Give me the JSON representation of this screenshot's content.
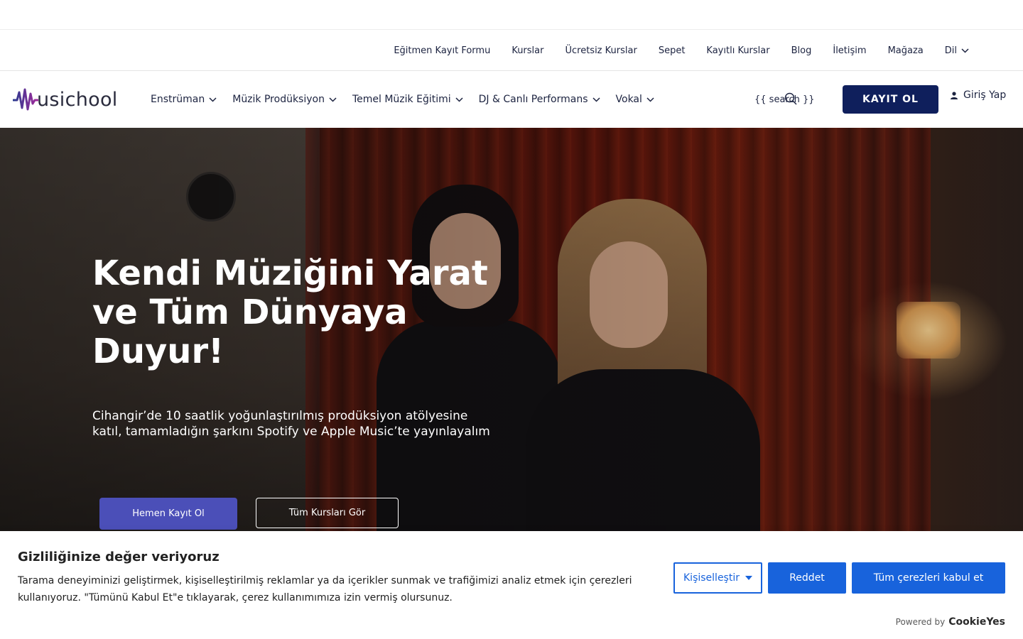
{
  "topbar": {
    "links": [
      "Eğitmen Kayıt Formu",
      "Kurslar",
      "Ücretsiz Kurslar",
      "Sepet",
      "Kayıtlı Kurslar",
      "Blog",
      "İletişim",
      "Mağaza"
    ],
    "language_label": "Dil"
  },
  "header": {
    "logo_text": "usichool",
    "menu": [
      {
        "label": "Enstrüman"
      },
      {
        "label": "Müzik Prodüksiyon"
      },
      {
        "label": "Temel Müzik Eğitimi"
      },
      {
        "label": "DJ & Canlı Performans"
      },
      {
        "label": "Vokal"
      }
    ],
    "search_placeholder": "{{ search }}",
    "register_label": "KAYIT OL",
    "login_label": "Giriş Yap"
  },
  "hero": {
    "title": "Kendi Müziğini Yarat ve Tüm Dünyaya Duyur!",
    "subtitle": "Cihangir’de 10 saatlik yoğunlaştırılmış prodüksiyon atölyesine katıl, tamamladığın şarkını Spotify ve Apple Music’te yayınlayalım",
    "primary_cta": "Hemen Kayıt Ol",
    "secondary_cta": "Tüm Kursları Gör"
  },
  "cookie_banner": {
    "title": "Gizliliğinize değer veriyoruz",
    "description": "Tarama deneyiminizi geliştirmek, kişiselleştirilmiş reklamlar ya da içerikler sunmak ve trafiğimizi analiz etmek için çerezleri kullanıyoruz. \"Tümünü Kabul Et\"e tıklayarak, çerez kullanımımıza izin vermiş olursunuz.",
    "customize_label": "Kişiselleştir",
    "reject_label": "Reddet",
    "accept_label": "Tüm çerezleri kabul et",
    "powered_by": "Powered by",
    "powered_brand": "CookieYes"
  },
  "colors": {
    "brand_navy": "#0f1f5c",
    "hero_button": "#4b4fb8",
    "cookie_blue": "#1863dc"
  }
}
